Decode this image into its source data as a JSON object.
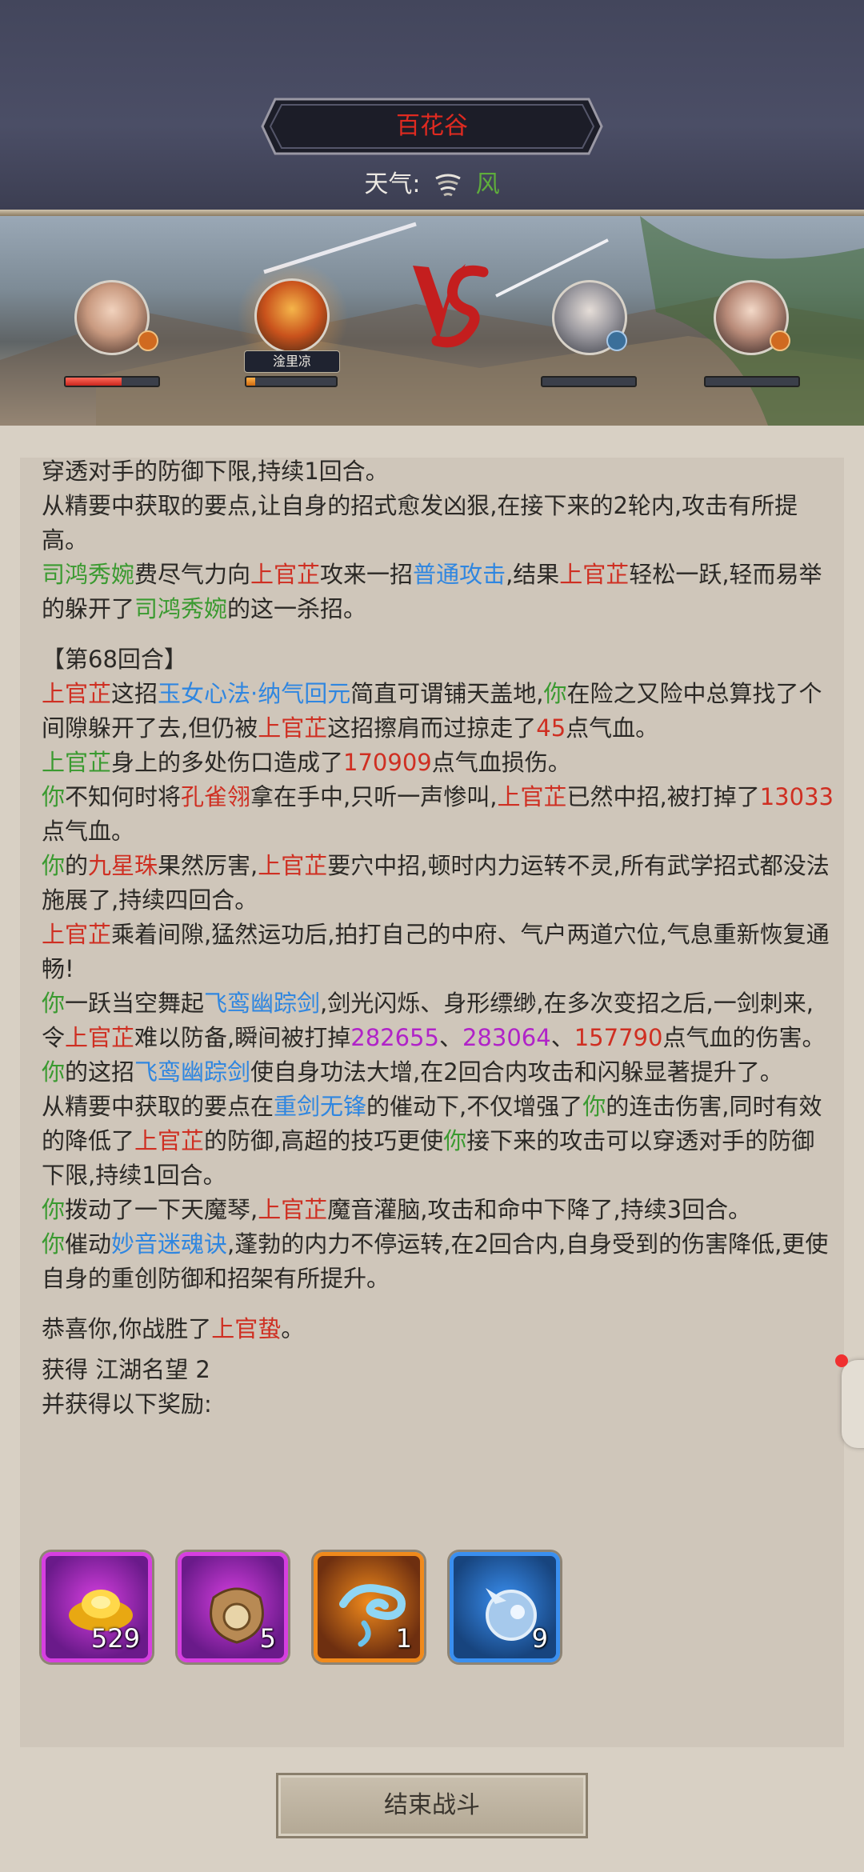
{
  "header": {
    "location": "百花谷",
    "weather_label": "天气:",
    "weather_icon": "wind-icon",
    "weather_value": "风"
  },
  "battle": {
    "vs_label": "VS",
    "active_name": "淦里凉",
    "team_left": [
      {
        "id": "ally-1",
        "hp": 0.6
      },
      {
        "id": "ally-2",
        "hp": 0.1
      }
    ],
    "team_right": [
      {
        "id": "enemy-1",
        "hp": 0
      },
      {
        "id": "enemy-2",
        "hp": 0
      }
    ]
  },
  "log": {
    "p1": {
      "a": "穿透对手的防御下限,持续1回合。"
    },
    "p2": {
      "a": "从精要中获取的要点,让自身的招式愈发凶狠,在接下来的2轮内,攻击有所提高。"
    },
    "p3": {
      "a": "司鸿秀婉",
      "b": "费尽气力向",
      "c": "上官芷",
      "d": "攻来一招",
      "e": "普通攻击",
      "f": ",结果",
      "g": "上官芷",
      "h": "轻松一跃,轻而易举的躲开了",
      "i": "司鸿秀婉",
      "j": "的这一杀招。"
    },
    "round": "【第68回合】",
    "p4": {
      "a": "上官芷",
      "b": "这招",
      "c": "玉女心法·纳气回元",
      "d": "简直可谓铺天盖地,",
      "e": "你",
      "f": "在险之又险中总算找了个间隙躲开了去,但仍被",
      "g": "上官芷",
      "h": "这招擦肩而过掠走了",
      "i": "45",
      "j": "点气血。"
    },
    "p5": {
      "a": "上官芷",
      "b": "身上的多处伤口造成了",
      "c": "170909",
      "d": "点气血损伤。"
    },
    "p6": {
      "a": "你",
      "b": "不知何时将",
      "c": "孔雀翎",
      "d": "拿在手中,只听一声惨叫,",
      "e": "上官芷",
      "f": "已然中招,被打掉了",
      "g": "13033",
      "h": "点气血。"
    },
    "p7": {
      "a": "你",
      "b": "的",
      "c": "九星珠",
      "d": "果然厉害,",
      "e": "上官芷",
      "f": "要穴中招,顿时内力运转不灵,所有武学招式都没法施展了,持续四回合。"
    },
    "p8": {
      "a": "上官芷",
      "b": "乘着间隙,猛然运功后,拍打自己的中府、气户两道穴位,气息重新恢复通畅!"
    },
    "p9": {
      "a": "你",
      "b": "一跃当空舞起",
      "c": "飞鸾幽踪剑",
      "d": ",剑光闪烁、身形缥缈,在多次变招之后,一剑刺来,令",
      "e": "上官芷",
      "f": "难以防备,瞬间被打掉",
      "g": "282655",
      "h": "、",
      "i": "283064",
      "j": "、",
      "k": "157790",
      "l": "点气血的伤害。"
    },
    "p10": {
      "a": "你",
      "b": "的这招",
      "c": "飞鸾幽踪剑",
      "d": "使自身功法大增,在2回合内攻击和闪躲显著提升了。"
    },
    "p11": {
      "a": "从精要中获取的要点在",
      "b": "重剑无锋",
      "c": "的催动下,不仅增强了",
      "d": "你",
      "e": "的连击伤害,同时有效的降低了",
      "f": "上官芷",
      "g": "的防御,高超的技巧更使",
      "h": "你",
      "i": "接下来的攻击可以穿透对手的防御下限,持续1回合。"
    },
    "p12": {
      "a": "你",
      "b": "拨动了一下天魔琴,",
      "c": "上官芷",
      "d": "魔音灌脑,攻击和命中下降了,持续3回合。"
    },
    "p13": {
      "a": "你",
      "b": "催动",
      "c": "妙音迷魂诀",
      "d": ",蓬勃的内力不停运转,在2回合内,自身受到的伤害降低,更使自身的重创防御和招架有所提升。"
    },
    "victory": {
      "a": "恭喜你,你战胜了",
      "b": "上官蛰",
      "c": "。"
    },
    "gain": "获得 江湖名望 2",
    "reward_title": "并获得以下奖励:"
  },
  "rewards": [
    {
      "icon": "gold-ingot-icon",
      "qty": "529",
      "frame": "#d63fe0",
      "bg": "#6a1a8a"
    },
    {
      "icon": "treasure-pouch-icon",
      "qty": "5",
      "frame": "#d63fe0",
      "bg": "#6a1a8a"
    },
    {
      "icon": "spirit-cloud-icon",
      "qty": "1",
      "frame": "#f08a1c",
      "bg": "#6e2f10"
    },
    {
      "icon": "crystal-orb-icon",
      "qty": "9",
      "frame": "#3a8ff0",
      "bg": "#17447e"
    }
  ],
  "end_button": "结束战斗",
  "colors": {
    "damage": "#cf2f22",
    "player": "#3a9a30",
    "skill": "#2f86e0",
    "crit": "#b023c8"
  }
}
